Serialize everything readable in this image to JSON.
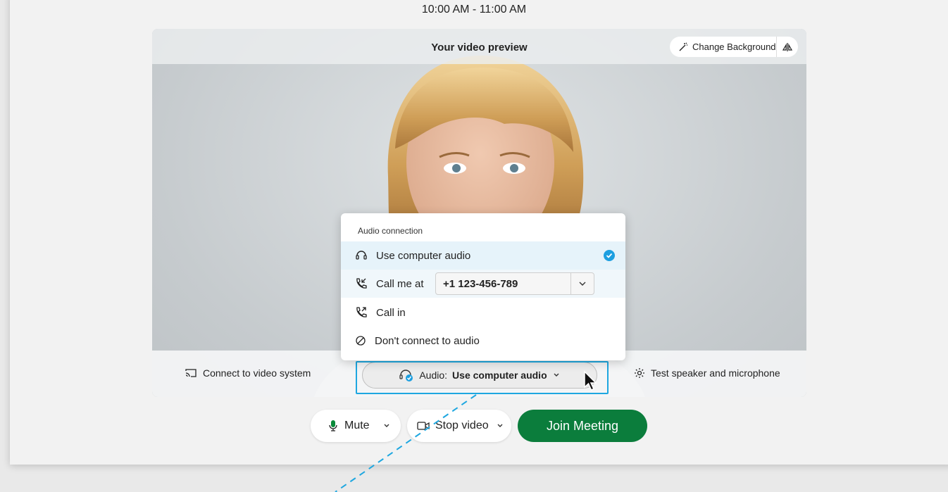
{
  "header": {
    "time_range": "10:00 AM - 11:00 AM"
  },
  "preview": {
    "title": "Your video preview",
    "change_background_label": "Change Background"
  },
  "bottom_bar": {
    "connect_video_label": "Connect to video system",
    "audio_prefix": "Audio:",
    "audio_value": "Use computer audio",
    "test_label": "Test speaker and microphone"
  },
  "audio_menu": {
    "title": "Audio connection",
    "items": [
      {
        "label": "Use computer audio",
        "icon": "headset-icon",
        "selected": true
      },
      {
        "label": "Call me at",
        "icon": "phone-incoming-icon",
        "phone_value": "+1 123-456-789"
      },
      {
        "label": "Call in",
        "icon": "phone-outgoing-icon"
      },
      {
        "label": "Don't connect to audio",
        "icon": "no-entry-icon"
      }
    ]
  },
  "controls": {
    "mute_label": "Mute",
    "stop_video_label": "Stop video",
    "join_label": "Join Meeting"
  },
  "colors": {
    "accent": "#1d9fe0",
    "join_green": "#0b7d3c",
    "mic_green": "#0a8a3a"
  }
}
